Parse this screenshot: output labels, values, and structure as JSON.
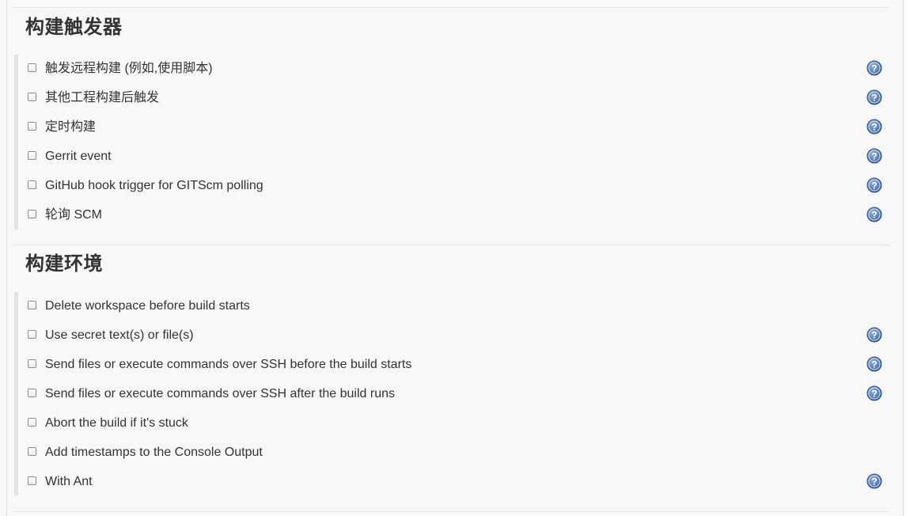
{
  "triggers": {
    "title": "构建触发器",
    "options": [
      {
        "label": "触发远程构建 (例如,使用脚本)",
        "checked": false,
        "help": true
      },
      {
        "label": "其他工程构建后触发",
        "checked": false,
        "help": true
      },
      {
        "label": "定时构建",
        "checked": false,
        "help": true
      },
      {
        "label": "Gerrit event",
        "checked": false,
        "help": true
      },
      {
        "label": "GitHub hook trigger for GITScm polling",
        "checked": false,
        "help": true
      },
      {
        "label": "轮询 SCM",
        "checked": false,
        "help": true
      }
    ]
  },
  "environment": {
    "title": "构建环境",
    "options": [
      {
        "label": "Delete workspace before build starts",
        "checked": false,
        "help": false
      },
      {
        "label": "Use secret text(s) or file(s)",
        "checked": false,
        "help": true
      },
      {
        "label": "Send files or execute commands over SSH before the build starts",
        "checked": false,
        "help": true
      },
      {
        "label": "Send files or execute commands over SSH after the build runs",
        "checked": false,
        "help": true
      },
      {
        "label": "Abort the build if it's stuck",
        "checked": false,
        "help": false
      },
      {
        "label": "Add timestamps to the Console Output",
        "checked": false,
        "help": false
      },
      {
        "label": "With Ant",
        "checked": false,
        "help": true
      }
    ]
  },
  "icons": {
    "help": "help-question-icon",
    "checkbox": "checkbox-unchecked"
  },
  "colors": {
    "background": "#f8f8f8",
    "text": "#333333",
    "help_icon_fill": "#5b82b5",
    "group_bar": "#e2e2e2",
    "rule": "#e3e3e3"
  }
}
